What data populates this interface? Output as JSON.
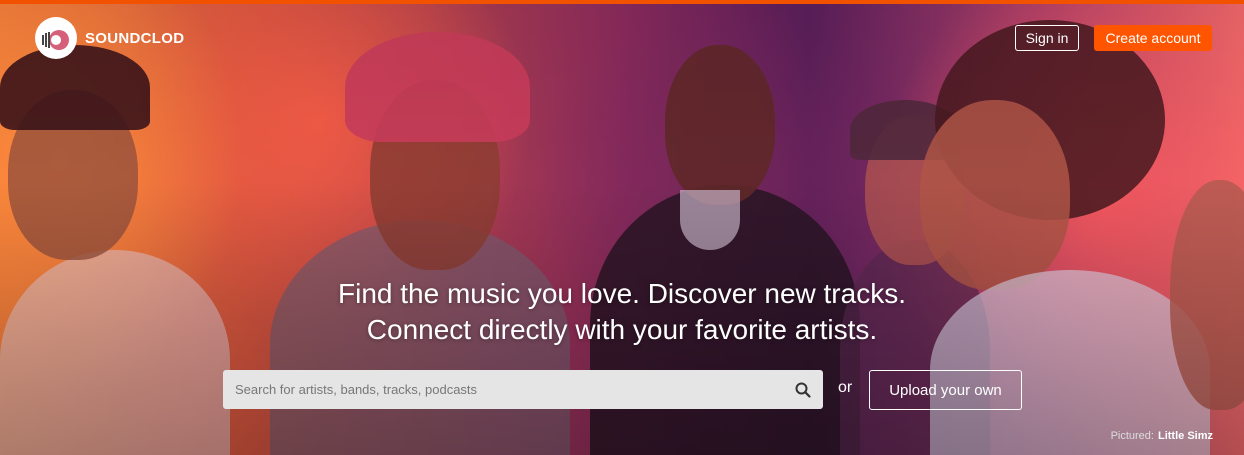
{
  "header": {
    "brand": "SOUNDCLOD",
    "sign_in": "Sign in",
    "create_account": "Create account"
  },
  "hero": {
    "line1": "Find the music you love. Discover new tracks.",
    "line2": "Connect directly with your favorite artists."
  },
  "search": {
    "placeholder": "Search for artists, bands, tracks, podcasts"
  },
  "or_text": "or",
  "upload_label": "Upload your own",
  "credit": {
    "prefix": "Pictured:",
    "name": "Little Simz"
  },
  "colors": {
    "accent": "#ff5500",
    "search_bg": "#e5e5e5"
  },
  "icons": [
    "soundcloud-logo-icon",
    "search-icon"
  ]
}
